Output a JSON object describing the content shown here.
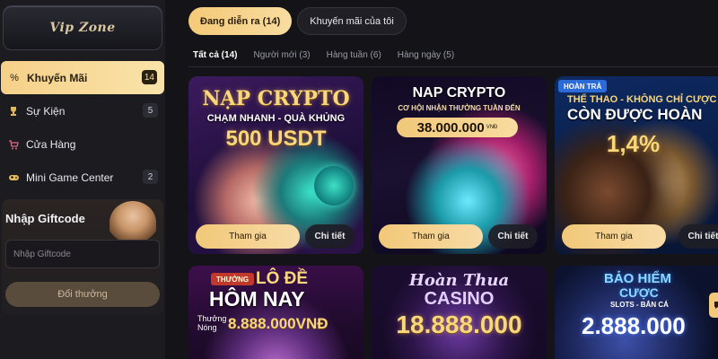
{
  "sidebar": {
    "vip_label": "Vip Zone",
    "menu": [
      {
        "label": "Khuyến Mãi",
        "count": "14",
        "icon": "percent-icon",
        "active": true
      },
      {
        "label": "Sự Kiện",
        "count": "5",
        "icon": "trophy-icon",
        "active": false
      },
      {
        "label": "Cửa Hàng",
        "count": "",
        "icon": "cart-icon",
        "active": false
      },
      {
        "label": "Mini Game Center",
        "count": "2",
        "icon": "gamepad-icon",
        "active": false
      }
    ],
    "giftcode": {
      "title": "Nhập Giftcode",
      "placeholder": "Nhập Giftcode",
      "button": "Đổi thưởng"
    }
  },
  "main": {
    "top_tabs": [
      {
        "label": "Đang diễn ra (14)",
        "active": true
      },
      {
        "label": "Khuyến mãi của tôi",
        "active": false
      }
    ],
    "sub_tabs": [
      {
        "label": "Tất cả (14)",
        "active": true
      },
      {
        "label": "Người mới (3)",
        "active": false
      },
      {
        "label": "Hàng tuần (6)",
        "active": false
      },
      {
        "label": "Hàng ngày (5)",
        "active": false
      }
    ],
    "cards": [
      {
        "line1": "NẠP CRYPTO",
        "line2": "CHẠM NHANH - QUÀ KHỦNG",
        "line3": "500 USDT",
        "join": "Tham gia",
        "detail": "Chi tiết"
      },
      {
        "line1": "NAP CRYPTO",
        "line2": "CƠ HỘI NHẬN THƯỞNG TUẦN ĐẾN",
        "line3": "38.000.000",
        "unit": "VNĐ",
        "join": "Tham gia",
        "detail": "Chi tiết"
      },
      {
        "badge": "HOÀN TRẢ",
        "line1": "THỂ THAO - KHÔNG CHỈ CƯỢC",
        "line2": "CÒN ĐƯỢC HOÀN",
        "line3": "1,4%",
        "join": "Tham gia",
        "detail": "Chi tiết"
      },
      {
        "badge": "THƯỞNG",
        "line1": "LÔ ĐỀ",
        "line2": "HÔM NAY",
        "line3a": "Thưởng",
        "line3b": "Nóng",
        "line3": "8.888.000VNĐ"
      },
      {
        "line1": "Hoàn Thua",
        "line2": "CASINO",
        "line3": "18.888.000"
      },
      {
        "line1": "BẢO HIỂM",
        "line2": "CƯỢC",
        "line3": "SLOTS - BẮN CÁ",
        "line4": "2.888.000"
      }
    ]
  },
  "colors": {
    "accent_gold": "#f5c978",
    "background": "#141418",
    "sidebar_bg": "#1b1b20"
  }
}
